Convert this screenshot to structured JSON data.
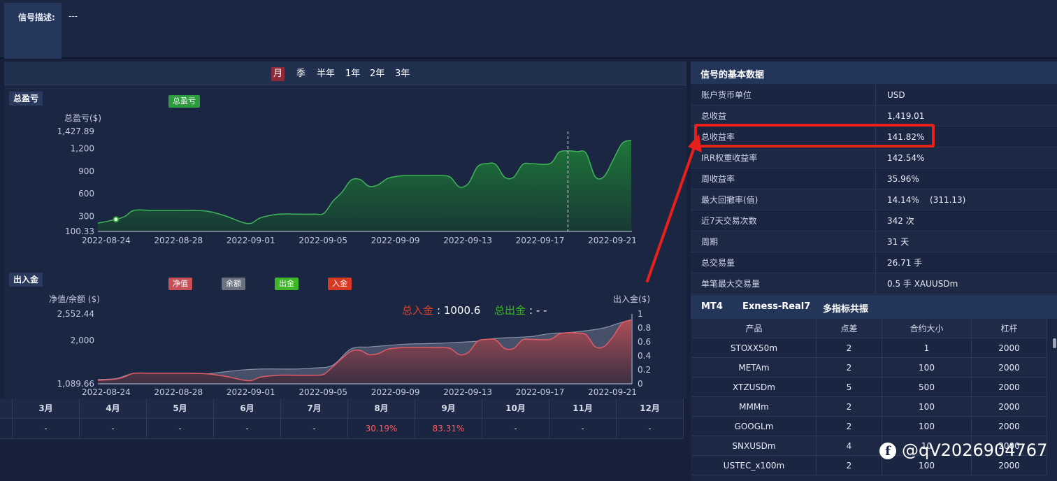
{
  "signal_desc": {
    "label": "信号描述:",
    "value": "---"
  },
  "periods": [
    {
      "label": "月",
      "active": true
    },
    {
      "label": "季",
      "active": false
    },
    {
      "label": "半年",
      "active": false
    },
    {
      "label": "1年",
      "active": false
    },
    {
      "label": "2年",
      "active": false
    },
    {
      "label": "3年",
      "active": false
    }
  ],
  "pnl_section": {
    "tag": "总盈亏",
    "legend": "总盈亏",
    "legend_color": "#2e9b3e"
  },
  "flow_section": {
    "tag": "出入金",
    "legends": [
      {
        "label": "净值",
        "color": "#c8505a"
      },
      {
        "label": "余额",
        "color": "#6b7282"
      },
      {
        "label": "出金",
        "color": "#3fb528"
      },
      {
        "label": "入金",
        "color": "#d63a24"
      }
    ],
    "total_in_label": "总入金",
    "total_in_value": ": 1000.6",
    "total_out_label": "总出金",
    "total_out_value": ": - -"
  },
  "chart_data": [
    {
      "type": "area",
      "title": "",
      "ylabel": "总盈亏($)",
      "yticks": [
        "1,427.89",
        "1,200",
        "900",
        "600",
        "300",
        "100.33"
      ],
      "ytick_values": [
        1427.89,
        1200,
        900,
        600,
        300,
        100.33
      ],
      "ylim": [
        100.33,
        1427.89
      ],
      "xlim": [
        0,
        29
      ],
      "xticks": [
        "2022-08-24",
        "2022-08-28",
        "2022-09-01",
        "2022-09-05",
        "2022-09-09",
        "2022-09-13",
        "2022-09-17",
        "2022-09-21"
      ],
      "xtick_pos": [
        1,
        5,
        9,
        13,
        17,
        21,
        25,
        29
      ],
      "color": "#2e9b3e",
      "series": [
        {
          "name": "总盈亏",
          "x": [
            0,
            1,
            1.5,
            2,
            3,
            4,
            5,
            6,
            7,
            8,
            8.5,
            9,
            10,
            11,
            12,
            12.5,
            13,
            13.5,
            14,
            14.5,
            15,
            15.5,
            16,
            16.5,
            17,
            18,
            19,
            19.5,
            20,
            20.5,
            21,
            21.5,
            22,
            22.5,
            23,
            23.5,
            24,
            25,
            25.5,
            26,
            26.5,
            27,
            27.5,
            28,
            28.5,
            29,
            29.5
          ],
          "y": [
            210,
            260,
            300,
            380,
            380,
            380,
            380,
            370,
            310,
            220,
            210,
            280,
            330,
            330,
            330,
            340,
            500,
            620,
            780,
            790,
            700,
            720,
            800,
            830,
            840,
            840,
            840,
            820,
            690,
            740,
            960,
            1000,
            990,
            820,
            820,
            990,
            1000,
            1000,
            1150,
            1170,
            1160,
            1140,
            830,
            830,
            1050,
            1270,
            1310
          ]
        }
      ],
      "marker_point": {
        "x": 1,
        "y": 260
      },
      "crosshair_x": 26
    },
    {
      "type": "area",
      "title": "",
      "ylabel": "净值/余额 ($)",
      "ylabel_right": "出入金($)",
      "yticks": [
        "2,552.44",
        "2,000",
        "1,089.66"
      ],
      "ytick_values": [
        2552.44,
        2000,
        1089.66
      ],
      "ylim": [
        1089.66,
        2552.44
      ],
      "y2ticks": [
        "1",
        "0.8",
        "0.6",
        "0.4",
        "0.2",
        "0"
      ],
      "y2_values": [
        1,
        0.8,
        0.6,
        0.4,
        0.2,
        0
      ],
      "y2lim": [
        0,
        1
      ],
      "xlim": [
        0,
        29
      ],
      "xticks": [
        "2022-08-24",
        "2022-08-28",
        "2022-09-01",
        "2022-09-05",
        "2022-09-09",
        "2022-09-13",
        "2022-09-17",
        "2022-09-21"
      ],
      "xtick_pos": [
        1,
        5,
        9,
        13,
        17,
        21,
        25,
        29
      ],
      "series": [
        {
          "name": "余额",
          "color": "#6b7282",
          "x": [
            0,
            1,
            2,
            3,
            4,
            5,
            6,
            7,
            8,
            9,
            10,
            11,
            12,
            13,
            14,
            15,
            16,
            17,
            18,
            19,
            20,
            21,
            22,
            23,
            24,
            25,
            26,
            27,
            28,
            29,
            29.5
          ],
          "y": [
            1180,
            1200,
            1310,
            1310,
            1310,
            1310,
            1300,
            1340,
            1380,
            1400,
            1400,
            1400,
            1420,
            1480,
            1820,
            1860,
            1890,
            1920,
            1930,
            1940,
            1960,
            1980,
            2040,
            2060,
            2080,
            2140,
            2160,
            2200,
            2260,
            2380,
            2430
          ]
        },
        {
          "name": "净值",
          "color": "#c8505a",
          "x": [
            0,
            1,
            1.5,
            2,
            3,
            4,
            5,
            6,
            7,
            8,
            8.5,
            9,
            10,
            11,
            12,
            12.5,
            13,
            13.5,
            14,
            14.5,
            15,
            15.5,
            16,
            16.5,
            17,
            18,
            19,
            19.5,
            20,
            20.5,
            21,
            21.5,
            22,
            22.5,
            23,
            23.5,
            24,
            25,
            25.5,
            26,
            26.5,
            27,
            27.5,
            28,
            28.5,
            29,
            29.5
          ],
          "y": [
            1160,
            1190,
            1240,
            1310,
            1310,
            1310,
            1310,
            1300,
            1250,
            1170,
            1160,
            1230,
            1270,
            1270,
            1270,
            1290,
            1450,
            1620,
            1770,
            1790,
            1700,
            1720,
            1810,
            1840,
            1850,
            1850,
            1850,
            1830,
            1700,
            1750,
            1980,
            2020,
            2010,
            1830,
            1830,
            2010,
            2020,
            2020,
            2130,
            2160,
            2150,
            2120,
            1870,
            1870,
            2080,
            2360,
            2420
          ]
        }
      ],
      "flows": [
        {
          "type": "入金",
          "value": 0,
          "x": 0
        }
      ]
    }
  ],
  "month_table": {
    "headers": [
      "3月",
      "4月",
      "5月",
      "6月",
      "7月",
      "8月",
      "9月",
      "10月",
      "11月",
      "12月"
    ],
    "values": [
      "-",
      "-",
      "-",
      "-",
      "-",
      "30.19%",
      "83.31%",
      "-",
      "-",
      "-"
    ]
  },
  "basic": {
    "title": "信号的基本数据",
    "rows": [
      {
        "label": "账户货币单位",
        "value": "USD"
      },
      {
        "label": "总收益",
        "value": "1,419.01"
      },
      {
        "label": "总收益率",
        "value": "141.82%"
      },
      {
        "label": "IRR权重收益率",
        "value": "142.54%"
      },
      {
        "label": "周收益率",
        "value": "35.96%"
      },
      {
        "label": "最大回撤率(值)",
        "value": "14.14%    (311.13)"
      },
      {
        "label": "近7天交易次数",
        "value": "342 次"
      },
      {
        "label": "周期",
        "value": "31 天"
      },
      {
        "label": "总交易量",
        "value": "26.71 手"
      },
      {
        "label": "单笔最大交易量",
        "value": "0.5 手 XAUUSDm"
      }
    ]
  },
  "account": {
    "platform": "MT4",
    "server": "Exness-Real7",
    "strategy": "多指标共振"
  },
  "products": {
    "headers": [
      "产品",
      "点差",
      "合约大小",
      "杠杆"
    ],
    "rows": [
      [
        "STOXX50m",
        "2",
        "1",
        "2000"
      ],
      [
        "METAm",
        "2",
        "100",
        "2000"
      ],
      [
        "XTZUSDm",
        "5",
        "500",
        "2000"
      ],
      [
        "MMMm",
        "2",
        "100",
        "2000"
      ],
      [
        "GOOGLm",
        "2",
        "100",
        "2000"
      ],
      [
        "SNXUSDm",
        "4",
        "10",
        "2000"
      ],
      [
        "USTEC_x100m",
        "2",
        "100",
        "2000"
      ]
    ]
  },
  "watermark": {
    "logo": "f",
    "text": "@qV2026904767"
  },
  "colors": {
    "highlight": "#e8201b",
    "accent_active": "#8e2a3a",
    "positive": "#ff5a63"
  }
}
